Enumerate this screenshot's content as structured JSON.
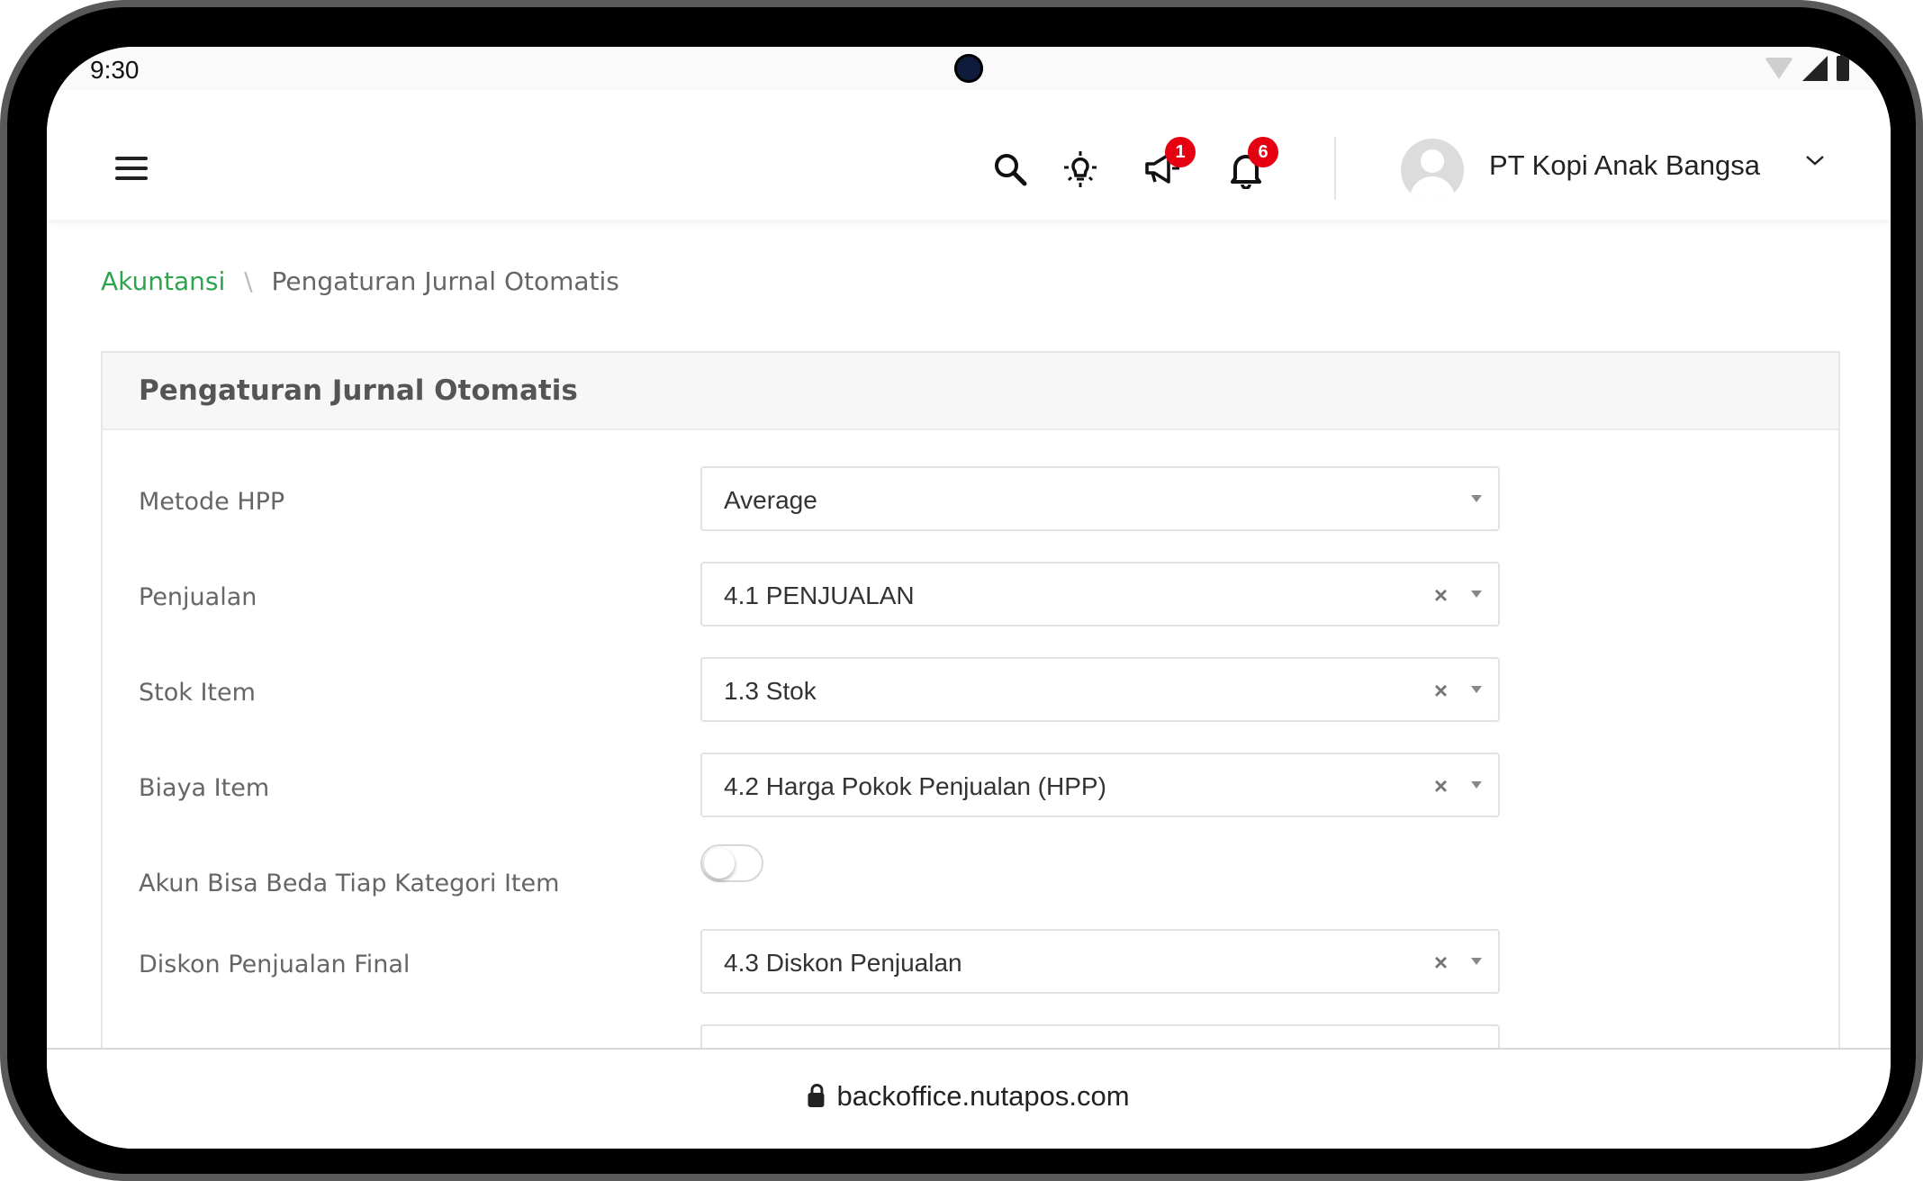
{
  "status_bar": {
    "time": "9:30"
  },
  "header": {
    "badges": {
      "announcements": "1",
      "notifications": "6"
    },
    "company_name": "PT Kopi Anak Bangsa"
  },
  "breadcrumb": {
    "parent": "Akuntansi",
    "separator": "\\",
    "current": "Pengaturan Jurnal Otomatis"
  },
  "panel": {
    "title": "Pengaturan Jurnal Otomatis",
    "rows": [
      {
        "label": "Metode HPP",
        "value": "Average",
        "clearable": false
      },
      {
        "label": "Penjualan",
        "value": "4.1 PENJUALAN",
        "clearable": true
      },
      {
        "label": "Stok Item",
        "value": "1.3 Stok",
        "clearable": true
      },
      {
        "label": "Biaya Item",
        "value": "4.2 Harga Pokok Penjualan (HPP)",
        "clearable": true
      },
      {
        "label": "Akun Bisa Beda Tiap Kategori Item",
        "toggle_on": false
      },
      {
        "label": "Diskon Penjualan Final",
        "value": "4.3 Diskon Penjualan",
        "clearable": true
      }
    ],
    "clear_symbol": "×"
  },
  "address_bar": {
    "url": "backoffice.nutapos.com"
  },
  "colors": {
    "accent_green": "#2ea44f",
    "badge_red": "#e60012"
  },
  "icons": [
    "menu-icon",
    "search-icon",
    "bulb-icon",
    "megaphone-icon",
    "bell-icon",
    "user-avatar-icon",
    "chevron-down-icon",
    "lock-icon",
    "wifi-icon",
    "signal-icon",
    "battery-icon"
  ]
}
